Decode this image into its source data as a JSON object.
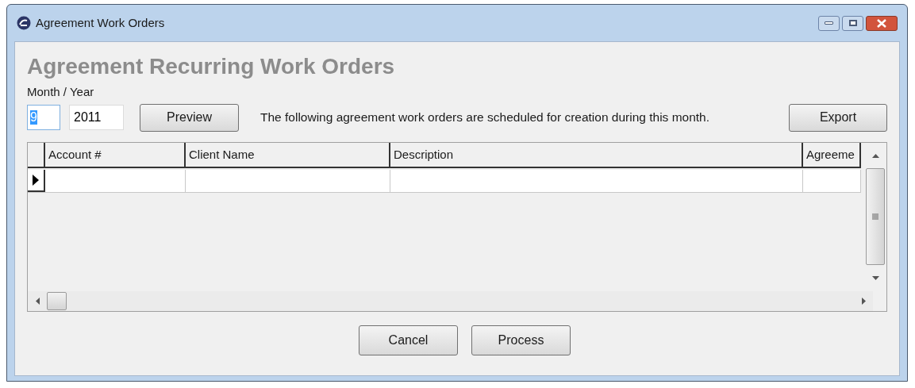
{
  "window": {
    "title": "Agreement Work Orders"
  },
  "heading": "Agreement Recurring Work Orders",
  "period": {
    "label": "Month / Year",
    "month": {
      "value": "9",
      "text_selected": true
    },
    "year": {
      "value": "2011"
    }
  },
  "preview_button": "Preview",
  "message": "The following agreement work orders are scheduled for creation during this month.",
  "export_button": "Export",
  "grid": {
    "columns": [
      "Account #",
      "Client Name",
      "Description",
      "Agreeme"
    ],
    "rows": [
      {
        "current": true
      }
    ]
  },
  "buttons": [
    "Cancel",
    "Process"
  ]
}
